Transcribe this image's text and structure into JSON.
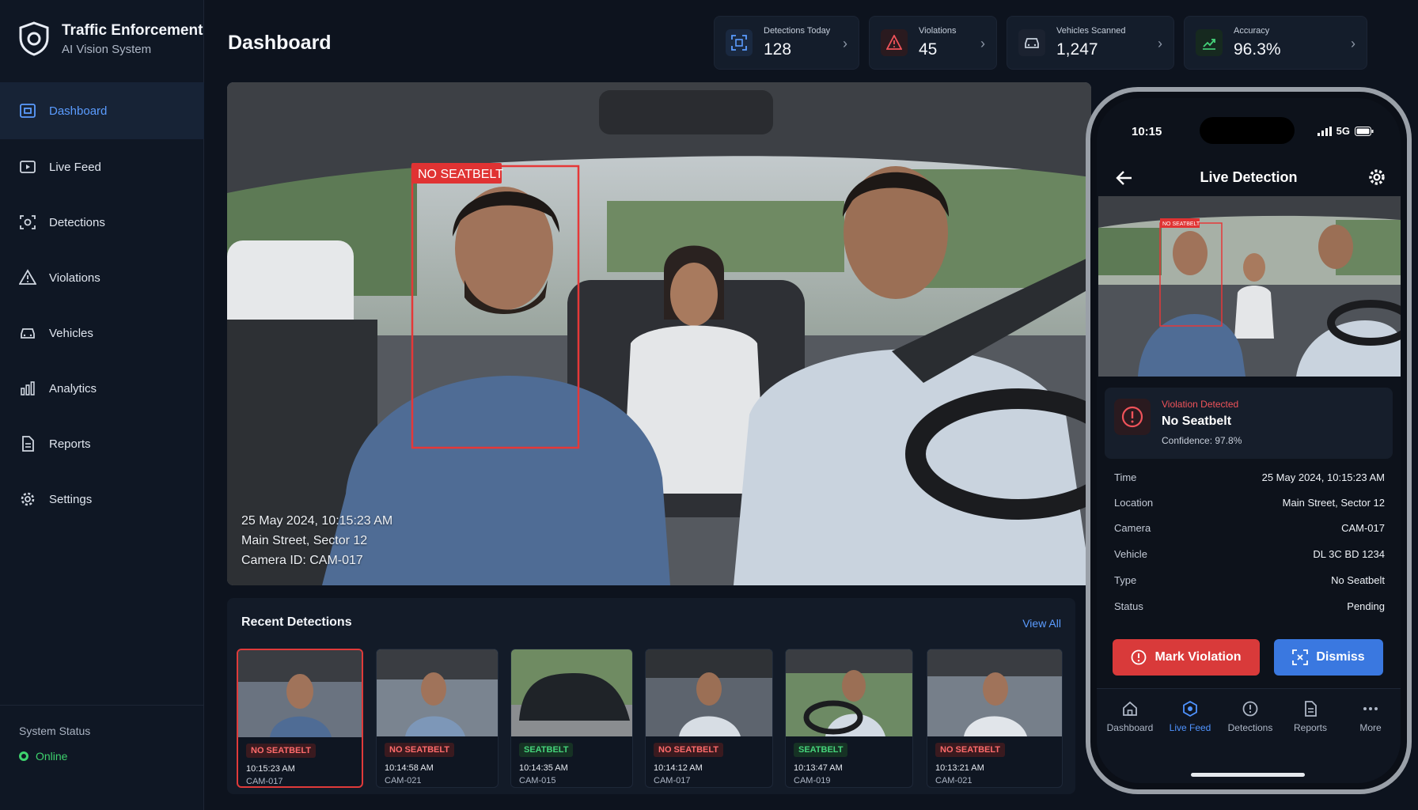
{
  "app": {
    "title": "Traffic Enforcement",
    "subtitle": "AI Vision System"
  },
  "sidebar": {
    "items": [
      {
        "label": "Dashboard",
        "icon": "dashboard-icon",
        "active": true
      },
      {
        "label": "Live Feed",
        "icon": "live-feed-icon"
      },
      {
        "label": "Detections",
        "icon": "detections-icon"
      },
      {
        "label": "Violations",
        "icon": "warning-icon"
      },
      {
        "label": "Vehicles",
        "icon": "car-icon"
      },
      {
        "label": "Analytics",
        "icon": "bar-chart-icon"
      },
      {
        "label": "Reports",
        "icon": "document-icon"
      },
      {
        "label": "Settings",
        "icon": "gear-icon"
      }
    ],
    "system_status_label": "System Status",
    "system_status_value": "Online"
  },
  "header": {
    "title": "Dashboard",
    "stats": [
      {
        "label": "Detections Today",
        "value": "128",
        "icon": "scan-icon",
        "color": "#5b9cff"
      },
      {
        "label": "Violations",
        "value": "45",
        "icon": "warning-icon",
        "color": "#f0535a"
      },
      {
        "label": "Vehicles Scanned",
        "value": "1,247",
        "icon": "car-icon",
        "color": "#c6cfdc"
      },
      {
        "label": "Accuracy",
        "value": "96.3%",
        "icon": "trend-icon",
        "color": "#45d37a"
      }
    ]
  },
  "feed": {
    "detection_label": "NO SEATBELT",
    "timestamp": "25 May 2024, 10:15:23 AM",
    "location": "Main Street, Sector 12",
    "camera": "Camera ID: CAM-017"
  },
  "recent": {
    "title": "Recent Detections",
    "view_all": "View All",
    "items": [
      {
        "status": "NO SEATBELT",
        "time": "10:15:23 AM",
        "camera": "CAM-017",
        "violation": true
      },
      {
        "status": "NO SEATBELT",
        "time": "10:14:58 AM",
        "camera": "CAM-021",
        "violation": true
      },
      {
        "status": "SEATBELT",
        "time": "10:14:35 AM",
        "camera": "CAM-015",
        "violation": false
      },
      {
        "status": "NO SEATBELT",
        "time": "10:14:12 AM",
        "camera": "CAM-017",
        "violation": true
      },
      {
        "status": "SEATBELT",
        "time": "10:13:47 AM",
        "camera": "CAM-019",
        "violation": false
      },
      {
        "status": "NO SEATBELT",
        "time": "10:13:21 AM",
        "camera": "CAM-021",
        "violation": true
      }
    ]
  },
  "phone": {
    "time": "10:15",
    "network": "5G",
    "title": "Live Detection",
    "detection_label": "NO SEATBELT",
    "alert": {
      "kicker": "Violation Detected",
      "title": "No Seatbelt",
      "confidence": "Confidence: 97.8%"
    },
    "details": [
      {
        "key": "Time",
        "value": "25 May 2024, 10:15:23 AM"
      },
      {
        "key": "Location",
        "value": "Main Street, Sector 12"
      },
      {
        "key": "Camera",
        "value": "CAM-017"
      },
      {
        "key": "Vehicle",
        "value": "DL 3C BD 1234"
      },
      {
        "key": "Type",
        "value": "No Seatbelt"
      },
      {
        "key": "Status",
        "value": "Pending"
      }
    ],
    "mark_button": "Mark Violation",
    "dismiss_button": "Dismiss",
    "tabs": [
      {
        "label": "Dashboard",
        "icon": "home-icon"
      },
      {
        "label": "Live Feed",
        "icon": "live-feed-icon",
        "active": true
      },
      {
        "label": "Detections",
        "icon": "alert-circle-icon"
      },
      {
        "label": "Reports",
        "icon": "document-icon"
      },
      {
        "label": "More",
        "icon": "more-icon"
      }
    ]
  }
}
